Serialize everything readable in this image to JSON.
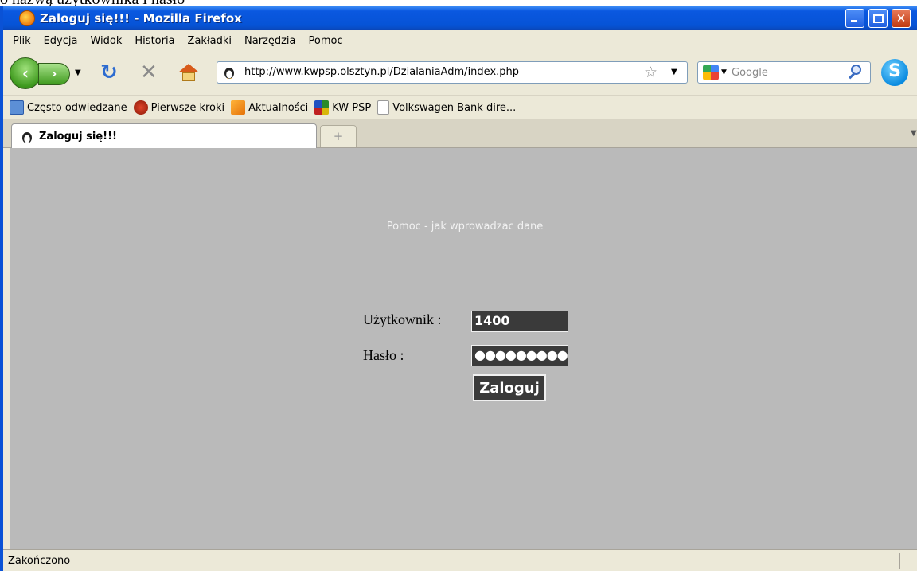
{
  "document_caption": "o nazwą użytkownika i hasło",
  "window": {
    "title": "Zaloguj się!!! - Mozilla Firefox",
    "icon": "firefox-icon"
  },
  "menubar": {
    "items": [
      "Plik",
      "Edycja",
      "Widok",
      "Historia",
      "Zakładki",
      "Narzędzia",
      "Pomoc"
    ]
  },
  "navbar": {
    "url": "http://www.kwpsp.olsztyn.pl/DzialaniaAdm/index.php",
    "search_placeholder": "Google"
  },
  "bookmarks": {
    "items": [
      "Często odwiedzane",
      "Pierwsze kroki",
      "Aktualności",
      "KW PSP",
      "Volkswagen Bank dire..."
    ]
  },
  "tabs": {
    "active_label": "Zaloguj się!!!",
    "new_tab_glyph": "+"
  },
  "page": {
    "help_link": "Pomoc - jak wprowadzac dane",
    "user_label": "Użytkownik :",
    "user_value": "1400",
    "pass_label": "Hasło :",
    "pass_value": "●●●●●●●●●",
    "login_button": "Zaloguj",
    "background_color": "#bababa",
    "field_color": "#3a3a3a"
  },
  "statusbar": {
    "text": "Zakończono"
  }
}
